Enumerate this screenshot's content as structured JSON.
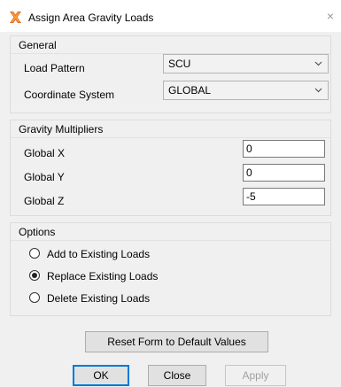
{
  "window": {
    "title": "Assign Area Gravity Loads",
    "close_glyph": "×"
  },
  "general": {
    "label": "General",
    "load_pattern_label": "Load Pattern",
    "load_pattern_value": "SCU",
    "coord_system_label": "Coordinate System",
    "coord_system_value": "GLOBAL"
  },
  "multipliers": {
    "label": "Gravity Multipliers",
    "global_x_label": "Global X",
    "global_x_value": "0",
    "global_y_label": "Global Y",
    "global_y_value": "0",
    "global_z_label": "Global Z",
    "global_z_value": "-5"
  },
  "options": {
    "label": "Options",
    "items": [
      {
        "label": "Add to Existing Loads",
        "selected": false
      },
      {
        "label": "Replace Existing Loads",
        "selected": true
      },
      {
        "label": "Delete Existing Loads",
        "selected": false
      }
    ]
  },
  "buttons": {
    "reset": "Reset Form to Default Values",
    "ok": "OK",
    "close": "Close",
    "apply": "Apply"
  },
  "icons": {
    "app": "csi-app-icon",
    "dropdown": "chevron-down-icon"
  },
  "colors": {
    "focus": "#0078d7",
    "dialog_bg": "#f0f0f0"
  }
}
